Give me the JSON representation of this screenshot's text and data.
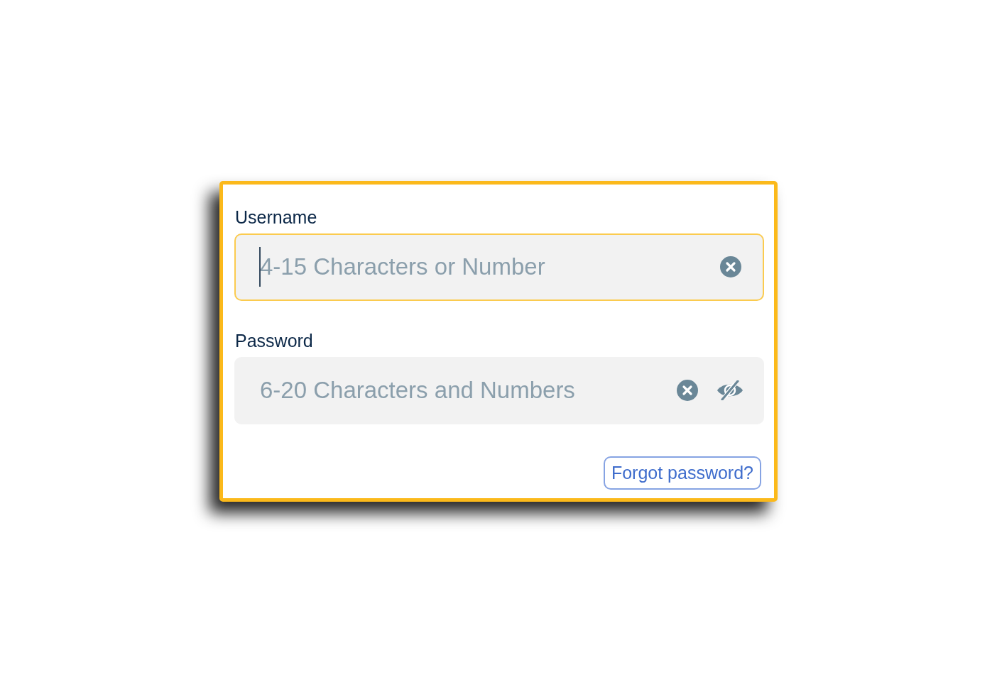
{
  "fields": [
    {
      "kind": "text",
      "label": "Username",
      "placeholder": "4-15 Characters or Number",
      "focused": true
    },
    {
      "kind": "password",
      "label": "Password",
      "placeholder": "6-20 Characters and Numbers",
      "focused": false,
      "revealed": false
    }
  ],
  "forgot_link": {
    "label": "Forgot password?"
  }
}
